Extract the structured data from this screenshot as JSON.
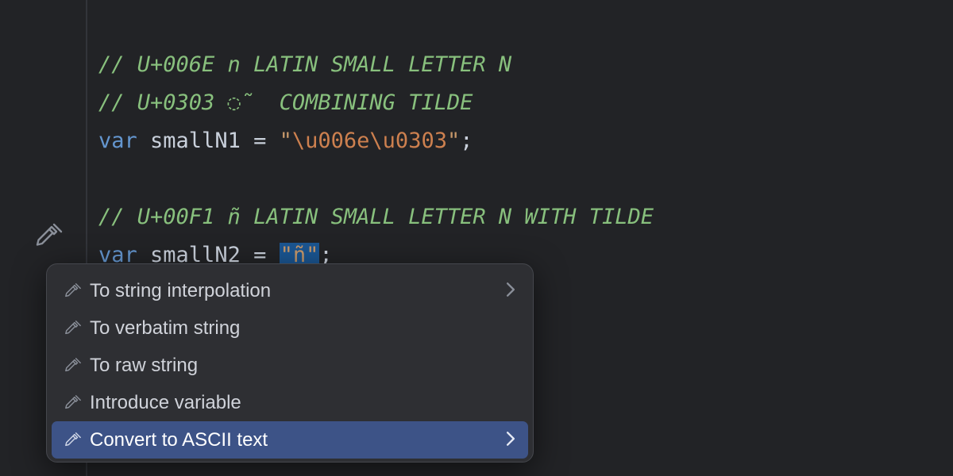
{
  "code": {
    "line1_comment": "// U+006E n LATIN SMALL LETTER N",
    "line2_comment": "// U+0303 ◌̃  COMBINING TILDE",
    "line3_keyword": "var",
    "line3_name": " smallN1 ",
    "line3_eq": "= ",
    "line3_q1": "\"",
    "line3_esc1": "\\u006e",
    "line3_esc2": "\\u0303",
    "line3_q2": "\"",
    "line3_semi": ";",
    "line5_comment": "// U+00F1 ñ LATIN SMALL LETTER N WITH TILDE",
    "line6_keyword": "var",
    "line6_name": " smallN2 ",
    "line6_eq": "= ",
    "line6_str": "\"ñ\"",
    "line6_semi": ";"
  },
  "popup": {
    "items": [
      {
        "label": "To string interpolation",
        "hasSubmenu": true,
        "selected": false
      },
      {
        "label": "To verbatim string",
        "hasSubmenu": false,
        "selected": false
      },
      {
        "label": "To raw string",
        "hasSubmenu": false,
        "selected": false
      },
      {
        "label": "Introduce variable",
        "hasSubmenu": false,
        "selected": false
      },
      {
        "label": "Convert to ASCII text",
        "hasSubmenu": true,
        "selected": true
      }
    ]
  }
}
